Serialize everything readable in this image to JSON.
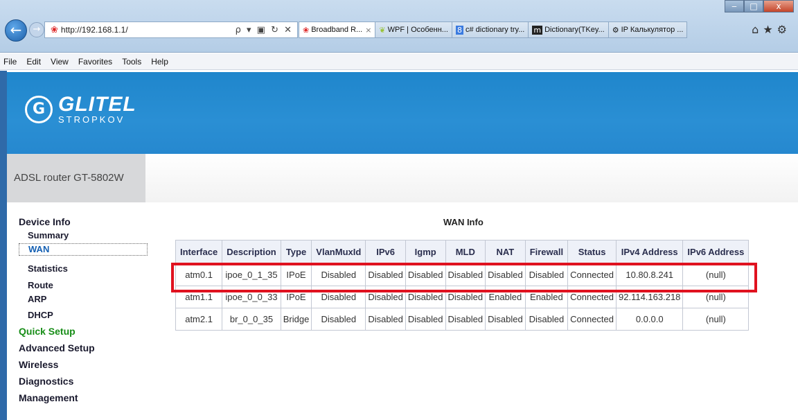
{
  "browser": {
    "address": "http://192.168.1.1/",
    "address_tools": "ρ ▾ ▣ ↻ ✕",
    "tabs": [
      {
        "label": "Broadband R...",
        "icon": "huawei-icon",
        "active": true
      },
      {
        "label": "WPF | Особенн...",
        "icon": "leaf-icon"
      },
      {
        "label": "c# dictionary try...",
        "icon": "google-icon"
      },
      {
        "label": "Dictionary(TKey...",
        "icon": "msdn-icon"
      },
      {
        "label": "IP Калькулятор ...",
        "icon": "gear-site-icon"
      }
    ],
    "menu": [
      "File",
      "Edit",
      "View",
      "Favorites",
      "Tools",
      "Help"
    ]
  },
  "header": {
    "logo_word": "GLITEL",
    "logo_sub": "STROPKOV",
    "model": "ADSL router GT-5802W"
  },
  "sidebar": {
    "device_info": "Device Info",
    "summary": "Summary",
    "wan": "WAN",
    "statistics": "Statistics",
    "route": "Route",
    "arp": "ARP",
    "dhcp": "DHCP",
    "quick_setup": "Quick Setup",
    "advanced_setup": "Advanced Setup",
    "wireless": "Wireless",
    "diagnostics": "Diagnostics",
    "management": "Management"
  },
  "wan": {
    "title": "WAN Info",
    "columns": [
      "Interface",
      "Description",
      "Type",
      "VlanMuxId",
      "IPv6",
      "Igmp",
      "MLD",
      "NAT",
      "Firewall",
      "Status",
      "IPv4 Address",
      "IPv6 Address"
    ],
    "rows": [
      [
        "atm0.1",
        "ipoe_0_1_35",
        "IPoE",
        "Disabled",
        "Disabled",
        "Disabled",
        "Disabled",
        "Disabled",
        "Disabled",
        "Connected",
        "10.80.8.241",
        "(null)"
      ],
      [
        "atm1.1",
        "ipoe_0_0_33",
        "IPoE",
        "Disabled",
        "Disabled",
        "Disabled",
        "Disabled",
        "Enabled",
        "Enabled",
        "Connected",
        "92.114.163.218",
        "(null)"
      ],
      [
        "atm2.1",
        "br_0_0_35",
        "Bridge",
        "Disabled",
        "Disabled",
        "Disabled",
        "Disabled",
        "Disabled",
        "Disabled",
        "Connected",
        "0.0.0.0",
        "(null)"
      ]
    ],
    "highlight_color": "#e0121f"
  },
  "colors": {
    "header_blue": "#2a8fd4",
    "quick_setup_green": "#178d17",
    "selected_blue": "#1560b3"
  }
}
